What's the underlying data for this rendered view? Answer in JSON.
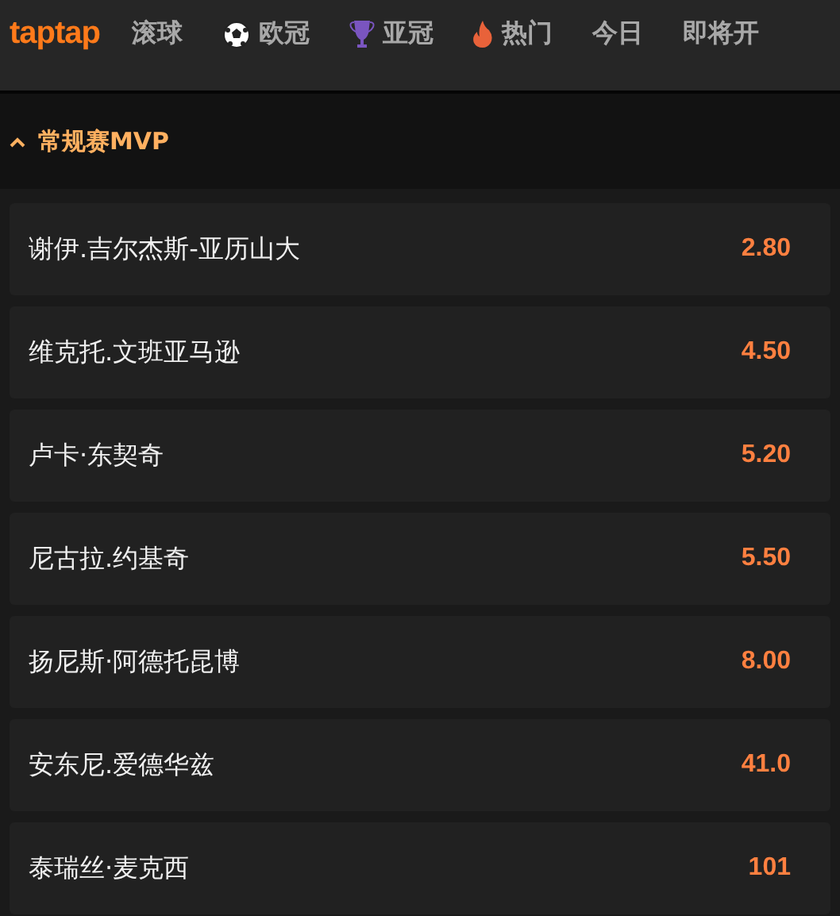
{
  "logo": "taptap",
  "nav": [
    {
      "label": "滚球",
      "kind": "plain"
    },
    {
      "label": "欧冠",
      "kind": "ball"
    },
    {
      "label": "亚冠",
      "kind": "trophy"
    },
    {
      "label": "热门",
      "kind": "fire"
    },
    {
      "label": "今日",
      "kind": "plain"
    },
    {
      "label": "即将开",
      "kind": "plain"
    }
  ],
  "section": {
    "title": "常规赛MVP",
    "expanded": true
  },
  "rows": [
    {
      "name": "谢伊.吉尔杰斯-亚历山大",
      "odds": "2.80"
    },
    {
      "name": "维克托.文班亚马逊",
      "odds": "4.50"
    },
    {
      "name": "卢卡·东契奇",
      "odds": "5.20"
    },
    {
      "name": "尼古拉.约基奇",
      "odds": "5.50"
    },
    {
      "name": "扬尼斯·阿德托昆博",
      "odds": "8.00"
    },
    {
      "name": "安东尼.爱德华兹",
      "odds": "41.0"
    },
    {
      "name": "泰瑞丝·麦克西",
      "odds": "101"
    }
  ]
}
